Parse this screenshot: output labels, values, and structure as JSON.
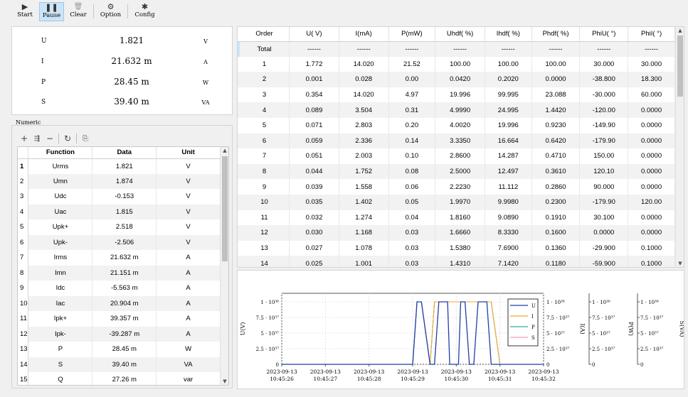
{
  "toolbar": {
    "start": "Start",
    "pause": "Pause",
    "clear": "Clear",
    "option": "Option",
    "config": "Config"
  },
  "summary": [
    {
      "label": "U",
      "value": "1.821",
      "unit": "V"
    },
    {
      "label": "I",
      "value": "21.632 m",
      "unit": "A"
    },
    {
      "label": "P",
      "value": "28.45 m",
      "unit": "W"
    },
    {
      "label": "S",
      "value": "39.40 m",
      "unit": "VA"
    }
  ],
  "numeric": {
    "caption": "Numeric",
    "columns": [
      "Function",
      "Data",
      "Unit"
    ],
    "rows": [
      {
        "n": "1",
        "f": "Urms",
        "d": "1.821",
        "u": "V"
      },
      {
        "n": "2",
        "f": "Umn",
        "d": "1.874",
        "u": "V"
      },
      {
        "n": "3",
        "f": "Udc",
        "d": "-0.153",
        "u": "V"
      },
      {
        "n": "4",
        "f": "Uac",
        "d": "1.815",
        "u": "V"
      },
      {
        "n": "5",
        "f": "Upk+",
        "d": "2.518",
        "u": "V"
      },
      {
        "n": "6",
        "f": "Upk-",
        "d": "-2.506",
        "u": "V"
      },
      {
        "n": "7",
        "f": "Irms",
        "d": "21.632 m",
        "u": "A"
      },
      {
        "n": "8",
        "f": "Imn",
        "d": "21.151 m",
        "u": "A"
      },
      {
        "n": "9",
        "f": "Idc",
        "d": "-5.563 m",
        "u": "A"
      },
      {
        "n": "10",
        "f": "Iac",
        "d": "20.904 m",
        "u": "A"
      },
      {
        "n": "11",
        "f": "Ipk+",
        "d": "39.357 m",
        "u": "A"
      },
      {
        "n": "12",
        "f": "Ipk-",
        "d": "-39.287 m",
        "u": "A"
      },
      {
        "n": "13",
        "f": "P",
        "d": "28.45 m",
        "u": "W"
      },
      {
        "n": "14",
        "f": "S",
        "d": "39.40 m",
        "u": "VA"
      },
      {
        "n": "15",
        "f": "Q",
        "d": "27.26 m",
        "u": "var"
      }
    ]
  },
  "harmonics": {
    "columns": [
      "Order",
      "U( V)",
      "I(mA)",
      "P(mW)",
      "Uhdf( %)",
      "Ihdf( %)",
      "Phdf( %)",
      "PhiU( °)",
      "PhiI( °)"
    ],
    "rows": [
      [
        "Total",
        "------",
        "------",
        "------",
        "------",
        "------",
        "------",
        "------",
        "------"
      ],
      [
        "1",
        "1.772",
        "14.020",
        "21.52",
        "100.00",
        "100.00",
        "100.00",
        "30.000",
        "30.000"
      ],
      [
        "2",
        "0.001",
        "0.028",
        "0.00",
        "0.0420",
        "0.2020",
        "0.0000",
        "-38.800",
        "18.300"
      ],
      [
        "3",
        "0.354",
        "14.020",
        "4.97",
        "19.996",
        "99.995",
        "23.088",
        "-30.000",
        "60.000"
      ],
      [
        "4",
        "0.089",
        "3.504",
        "0.31",
        "4.9990",
        "24.995",
        "1.4420",
        "-120.00",
        "0.0000"
      ],
      [
        "5",
        "0.071",
        "2.803",
        "0.20",
        "4.0020",
        "19.996",
        "0.9230",
        "-149.90",
        "0.0000"
      ],
      [
        "6",
        "0.059",
        "2.336",
        "0.14",
        "3.3350",
        "16.664",
        "0.6420",
        "-179.90",
        "0.0000"
      ],
      [
        "7",
        "0.051",
        "2.003",
        "0.10",
        "2.8600",
        "14.287",
        "0.4710",
        "150.00",
        "0.0000"
      ],
      [
        "8",
        "0.044",
        "1.752",
        "0.08",
        "2.5000",
        "12.497",
        "0.3610",
        "120.10",
        "0.0000"
      ],
      [
        "9",
        "0.039",
        "1.558",
        "0.06",
        "2.2230",
        "11.112",
        "0.2860",
        "90.000",
        "0.0000"
      ],
      [
        "10",
        "0.035",
        "1.402",
        "0.05",
        "1.9970",
        "9.9980",
        "0.2300",
        "-179.90",
        "120.00"
      ],
      [
        "11",
        "0.032",
        "1.274",
        "0.04",
        "1.8160",
        "9.0890",
        "0.1910",
        "30.100",
        "0.0000"
      ],
      [
        "12",
        "0.030",
        "1.168",
        "0.03",
        "1.6660",
        "8.3330",
        "0.1600",
        "0.0000",
        "0.0000"
      ],
      [
        "13",
        "0.027",
        "1.078",
        "0.03",
        "1.5380",
        "7.6900",
        "0.1360",
        "-29.900",
        "0.1000"
      ],
      [
        "14",
        "0.025",
        "1.001",
        "0.03",
        "1.4310",
        "7.1420",
        "0.1180",
        "-59.900",
        "0.1000"
      ]
    ]
  },
  "chart_data": {
    "type": "line",
    "ylabel": "U(V)",
    "extra_axes": [
      "I(A)",
      "P(W)",
      "S(VA)"
    ],
    "y_ticks": [
      "0",
      "2.5 · 10³⁷",
      "5 · 10³⁷",
      "7.5 · 10³⁷",
      "1 · 10³⁸"
    ],
    "ylim": [
      0,
      1e+38
    ],
    "x_ticks": [
      {
        "date": "2023-09-13",
        "time": "10:45:26"
      },
      {
        "date": "2023-09-13",
        "time": "10:45:27"
      },
      {
        "date": "2023-09-13",
        "time": "10:45:28"
      },
      {
        "date": "2023-09-13",
        "time": "10:45:29"
      },
      {
        "date": "2023-09-13",
        "time": "10:45:30"
      },
      {
        "date": "2023-09-13",
        "time": "10:45:31"
      },
      {
        "date": "2023-09-13",
        "time": "10:45:32"
      }
    ],
    "legend_position": "right",
    "grid": true,
    "series": [
      {
        "name": "U",
        "color": "#1f3fa8",
        "x": [
          26.0,
          29.0,
          29.1,
          29.2,
          29.4,
          29.5,
          29.6,
          29.8,
          29.85,
          30.05,
          30.1,
          30.2,
          30.3,
          30.4,
          30.5,
          30.6,
          30.7,
          30.8,
          31.0,
          32.0
        ],
        "y": [
          0,
          0,
          1e+38,
          1e+38,
          0,
          0,
          1e+38,
          1e+38,
          0,
          0,
          1e+38,
          1e+38,
          0,
          0,
          1e+38,
          1e+38,
          1e+38,
          0,
          0,
          0
        ]
      },
      {
        "name": "I",
        "color": "#f0a830",
        "x": [
          26.0,
          29.0,
          29.1,
          29.2,
          29.4,
          29.5,
          30.8,
          31.0,
          32.0
        ],
        "y": [
          0,
          0,
          1e+38,
          1e+38,
          0,
          1e+38,
          1e+38,
          0,
          0
        ]
      },
      {
        "name": "P",
        "color": "#3aa896",
        "x": [
          26.0,
          29.0,
          29.1,
          29.2,
          29.4,
          29.5,
          30.8,
          31.0,
          32.0
        ],
        "y": [
          0,
          0,
          1e+38,
          1e+38,
          0,
          1e+38,
          1e+38,
          0,
          0
        ]
      },
      {
        "name": "S",
        "color": "#f0a0b8",
        "x": [
          26.0,
          29.0,
          29.1,
          29.2,
          29.4,
          29.5,
          30.8,
          31.0,
          32.0
        ],
        "y": [
          0,
          0,
          1e+38,
          1e+38,
          0,
          1e+38,
          1e+38,
          0,
          0
        ]
      }
    ]
  }
}
